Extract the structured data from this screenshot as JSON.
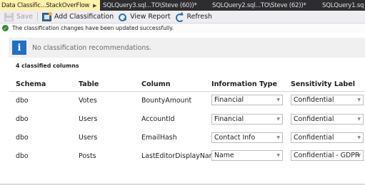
{
  "tabs": [
    {
      "label": "Data Classific...StackOverFlow",
      "active": true
    },
    {
      "label": "SQLQuery3.sql...TO\\Steve (60))*",
      "active": false
    },
    {
      "label": "SQLQuery2.sql...TO\\Steve (62))*",
      "active": false
    },
    {
      "label": "SQLQuery1.sq",
      "active": false
    }
  ],
  "tab_icons": {
    "pin": "pin-icon",
    "close": "close-icon"
  },
  "toolbar": {
    "save_label": "Save",
    "add_classification_label": "Add Classification",
    "view_report_label": "View Report",
    "refresh_label": "Refresh"
  },
  "status": {
    "message": "The classification changes have been updated successfully.",
    "icon": "success-check-icon"
  },
  "recommendations": {
    "message": "No classification recommendations.",
    "icon": "info-icon"
  },
  "classified_count_label": "4 classified columns",
  "table": {
    "headers": [
      "Schema",
      "Table",
      "Column",
      "Information Type",
      "Sensitivity Label"
    ],
    "rows": [
      {
        "schema": "dbo",
        "table": "Votes",
        "column": "BountyAmount",
        "info_type": "Financial",
        "sensitivity": "Confidential"
      },
      {
        "schema": "dbo",
        "table": "Users",
        "column": "AccountId",
        "info_type": "Financial",
        "sensitivity": "Confidential"
      },
      {
        "schema": "dbo",
        "table": "Users",
        "column": "EmailHash",
        "info_type": "Contact Info",
        "sensitivity": "Confidential"
      },
      {
        "schema": "dbo",
        "table": "Posts",
        "column": "LastEditorDisplayName",
        "info_type": "Name",
        "sensitivity": "Confidential - GDPR"
      }
    ]
  },
  "colors": {
    "active_tab": "#fff1a8",
    "tabstrip": "#2d2d30",
    "toolbar": "#eeeef2",
    "success": "#2e8b3a",
    "info": "#1f6fc5"
  }
}
